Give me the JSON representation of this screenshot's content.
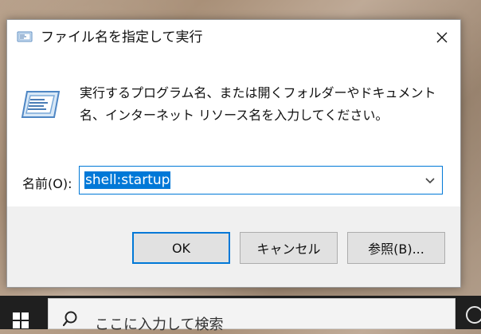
{
  "dialog": {
    "title": "ファイル名を指定して実行",
    "description": "実行するプログラム名、または開くフォルダーやドキュメント名、インターネット リソース名を入力してください。",
    "name_label": "名前(O):",
    "name_value": "shell:startup",
    "buttons": {
      "ok": "OK",
      "cancel": "キャンセル",
      "browse": "参照(B)..."
    }
  },
  "taskbar": {
    "search_placeholder": "ここに入力して検索"
  },
  "colors": {
    "accent": "#0078d7",
    "dialog_bg": "#f0f0f0",
    "taskbar_bg": "#1f1f1f"
  },
  "icons": {
    "title": "run-icon",
    "close": "close-icon",
    "dropdown": "chevron-down-icon",
    "start": "windows-logo-icon",
    "search": "search-icon"
  }
}
